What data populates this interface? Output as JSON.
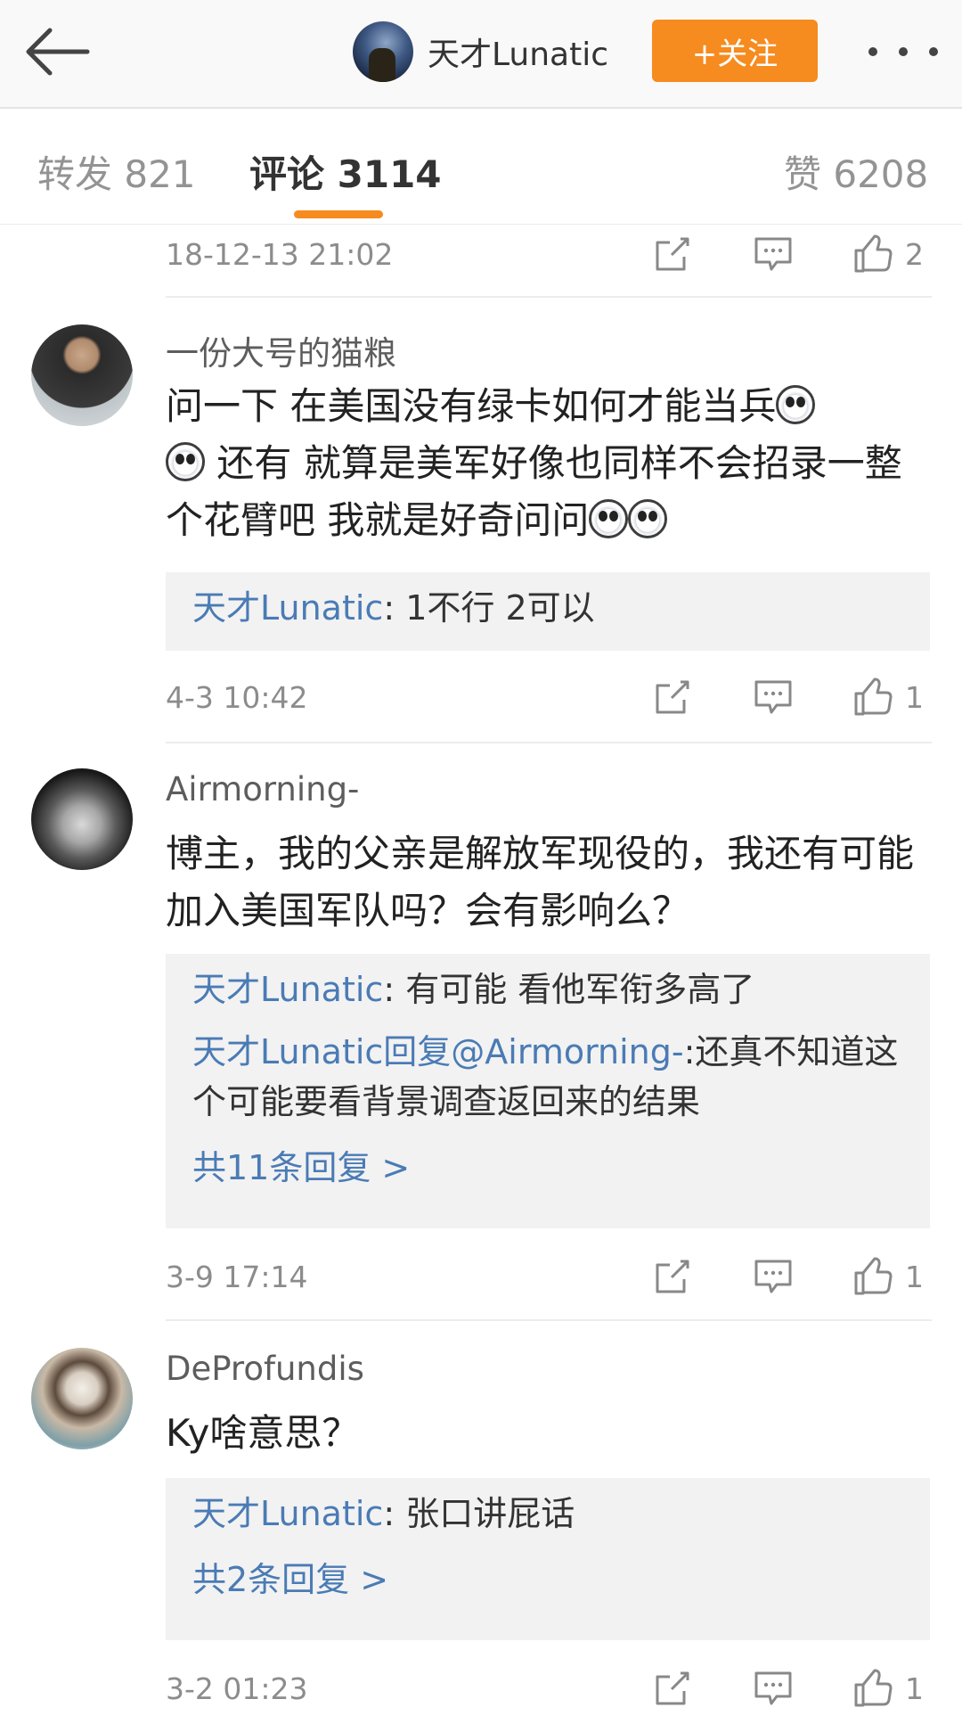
{
  "header": {
    "back_icon": "arrow-left-icon",
    "username": "天才Lunatic",
    "follow_label": "+关注",
    "more_icon": "more-dots-icon"
  },
  "tabs": {
    "repost": "转发 821",
    "comments": "评论 3114",
    "likes": "赞 6208"
  },
  "colors": {
    "accent": "#f68b1f",
    "link": "#4a7bb5",
    "reply_bg": "#f2f2f2"
  },
  "top_row": {
    "time": "18-12-13 21:02",
    "likes": "2"
  },
  "comments": [
    {
      "username": "一份大号的猫粮",
      "text_parts": [
        "问一下 在美国没有绿卡如何才能当兵",
        " 还有 就算是美军好像也同样不会招录一整个花臂吧 我就是好奇问问"
      ],
      "emojis": [
        "huaxin-emoji",
        "huaxin-emoji",
        "huaxin-emoji",
        "huaxin-emoji"
      ],
      "replies": [
        {
          "author": "天才Lunatic",
          "text": ": 1不行 2可以"
        }
      ],
      "time": "4-3 10:42",
      "likes": "1"
    },
    {
      "username": "Airmorning-",
      "text": "博主，我的父亲是解放军现役的，我还有可能加入美国军队吗？会有影响么？",
      "replies": [
        {
          "author": "天才Lunatic",
          "text": ": 有可能 看他军衔多高了"
        },
        {
          "author": "天才Lunatic回复@Airmorning-",
          "text": ":还真不知道这个可能要看背景调查返回来的结果"
        }
      ],
      "more_replies": "共11条回复 >",
      "time": "3-9 17:14",
      "likes": "1"
    },
    {
      "username": "DeProfundis",
      "text": "Ky啥意思？",
      "replies": [
        {
          "author": "天才Lunatic",
          "text": ": 张口讲屁话"
        }
      ],
      "more_replies": "共2条回复 >",
      "time": "3-2 01:23",
      "likes": "1"
    }
  ],
  "action_icons": [
    "share-icon",
    "comment-icon",
    "like-thumb-icon"
  ]
}
